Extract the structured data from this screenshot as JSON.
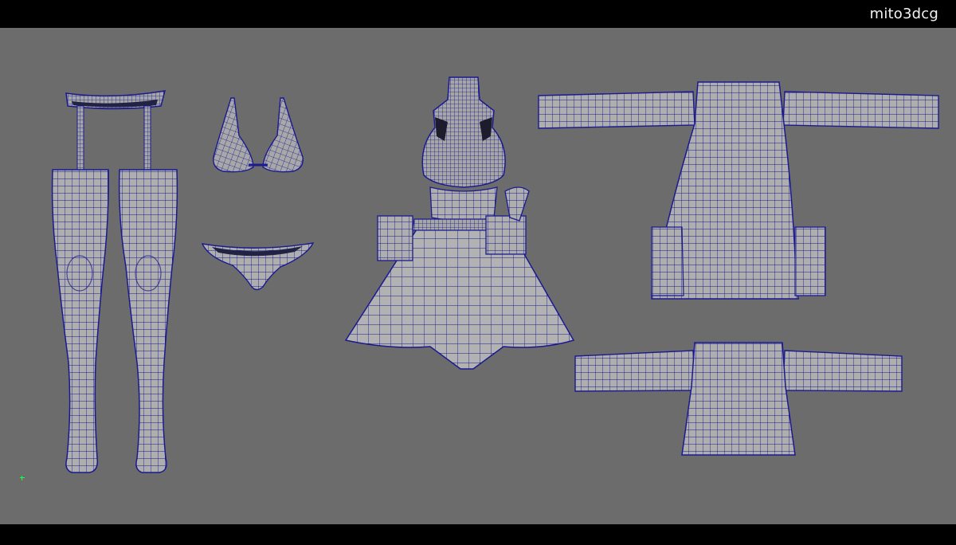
{
  "watermark": "mito3dcg",
  "colors": {
    "viewport_bg": "#6c6c6c",
    "mesh_fill": "#aeaeae",
    "wire": "#1b1a8f",
    "inner": "#222244",
    "pivot": "#19ff3a"
  },
  "objects": [
    {
      "name": "garter-belt"
    },
    {
      "name": "stocking-left"
    },
    {
      "name": "stocking-right"
    },
    {
      "name": "bra"
    },
    {
      "name": "panties"
    },
    {
      "name": "dress"
    },
    {
      "name": "jacket-long"
    },
    {
      "name": "jacket-short"
    }
  ],
  "pivot_icon": "pivot-cross-icon"
}
